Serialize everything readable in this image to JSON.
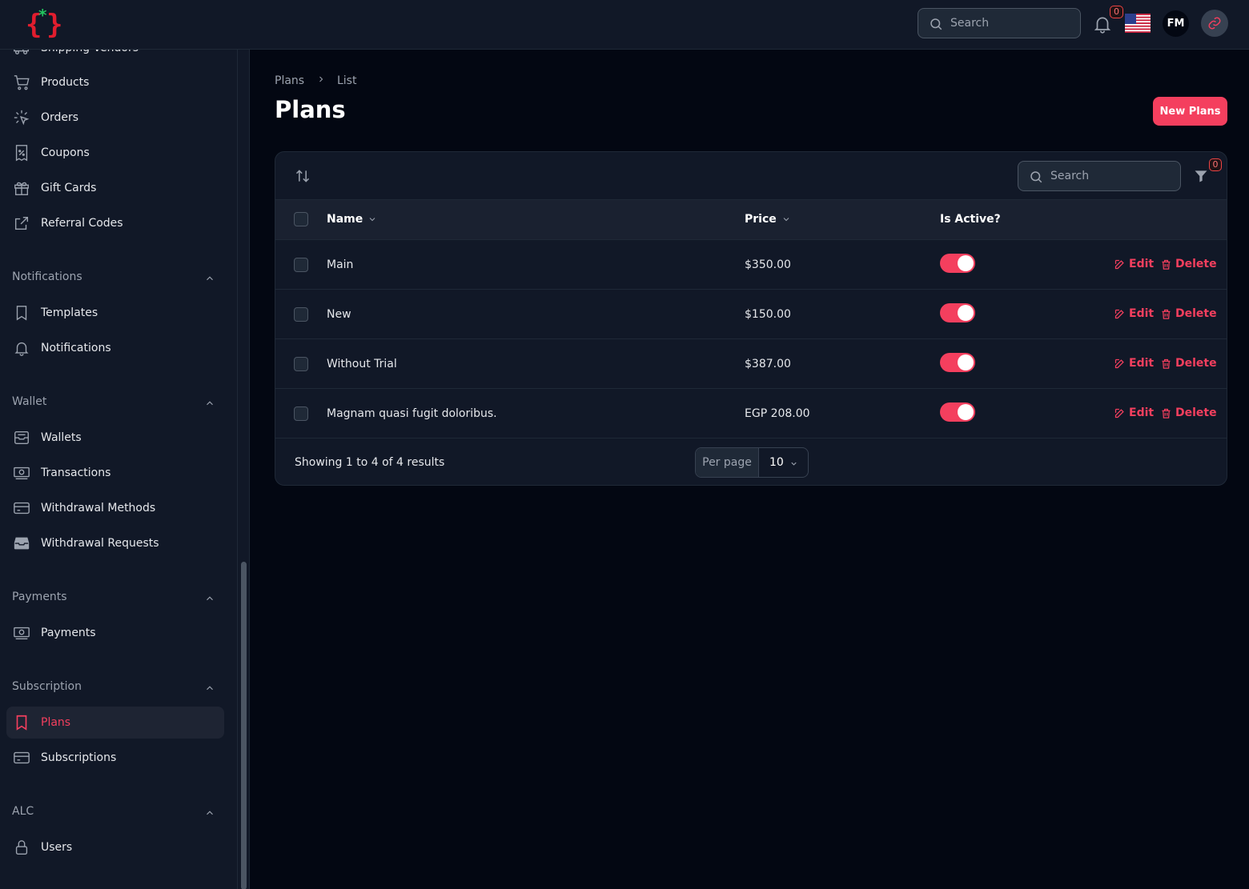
{
  "topbar": {
    "search_placeholder": "Search",
    "notifications_count": "0",
    "user_initials": "FM"
  },
  "sidebar": {
    "items_top": [
      {
        "label": "Shipping Vendors",
        "icon": "truck-icon"
      },
      {
        "label": "Products",
        "icon": "cart-icon"
      },
      {
        "label": "Orders",
        "icon": "cursor-click-icon"
      },
      {
        "label": "Coupons",
        "icon": "receipt-percent-icon"
      },
      {
        "label": "Gift Cards",
        "icon": "gift-icon"
      },
      {
        "label": "Referral Codes",
        "icon": "external-link-icon"
      }
    ],
    "groups": [
      {
        "label": "Notifications",
        "items": [
          {
            "label": "Templates",
            "icon": "bookmark-icon"
          },
          {
            "label": "Notifications",
            "icon": "bell-icon"
          }
        ]
      },
      {
        "label": "Wallet",
        "items": [
          {
            "label": "Wallets",
            "icon": "inbox-icon"
          },
          {
            "label": "Transactions",
            "icon": "banknotes-icon"
          },
          {
            "label": "Withdrawal Methods",
            "icon": "credit-card-icon"
          },
          {
            "label": "Withdrawal Requests",
            "icon": "inbox-stack-icon"
          }
        ]
      },
      {
        "label": "Payments",
        "items": [
          {
            "label": "Payments",
            "icon": "banknotes-icon"
          }
        ]
      },
      {
        "label": "Subscription",
        "items": [
          {
            "label": "Plans",
            "icon": "bookmark-icon",
            "active": true
          },
          {
            "label": "Subscriptions",
            "icon": "credit-card-icon"
          }
        ]
      },
      {
        "label": "ALC",
        "items": [
          {
            "label": "Users",
            "icon": "lock-icon"
          }
        ]
      }
    ]
  },
  "breadcrumb": {
    "parent": "Plans",
    "current": "List"
  },
  "page": {
    "title": "Plans",
    "new_button": "New Plans"
  },
  "table": {
    "search_placeholder": "Search",
    "filter_count": "0",
    "columns": {
      "name": "Name",
      "price": "Price",
      "active": "Is Active?"
    },
    "rows": [
      {
        "name": "Main",
        "price": "$350.00",
        "active": true
      },
      {
        "name": "New",
        "price": "$150.00",
        "active": true
      },
      {
        "name": "Without Trial",
        "price": "$387.00",
        "active": true
      },
      {
        "name": "Magnam quasi fugit doloribus.",
        "price": "EGP 208.00",
        "active": true
      }
    ],
    "actions": {
      "edit": "Edit",
      "delete": "Delete"
    },
    "footer": {
      "showing": "Showing 1 to 4 of 4 results",
      "per_page_label": "Per page",
      "per_page_value": "10"
    }
  },
  "colors": {
    "accent": "#f43f5e",
    "background": "#030712",
    "panel": "#111827"
  }
}
